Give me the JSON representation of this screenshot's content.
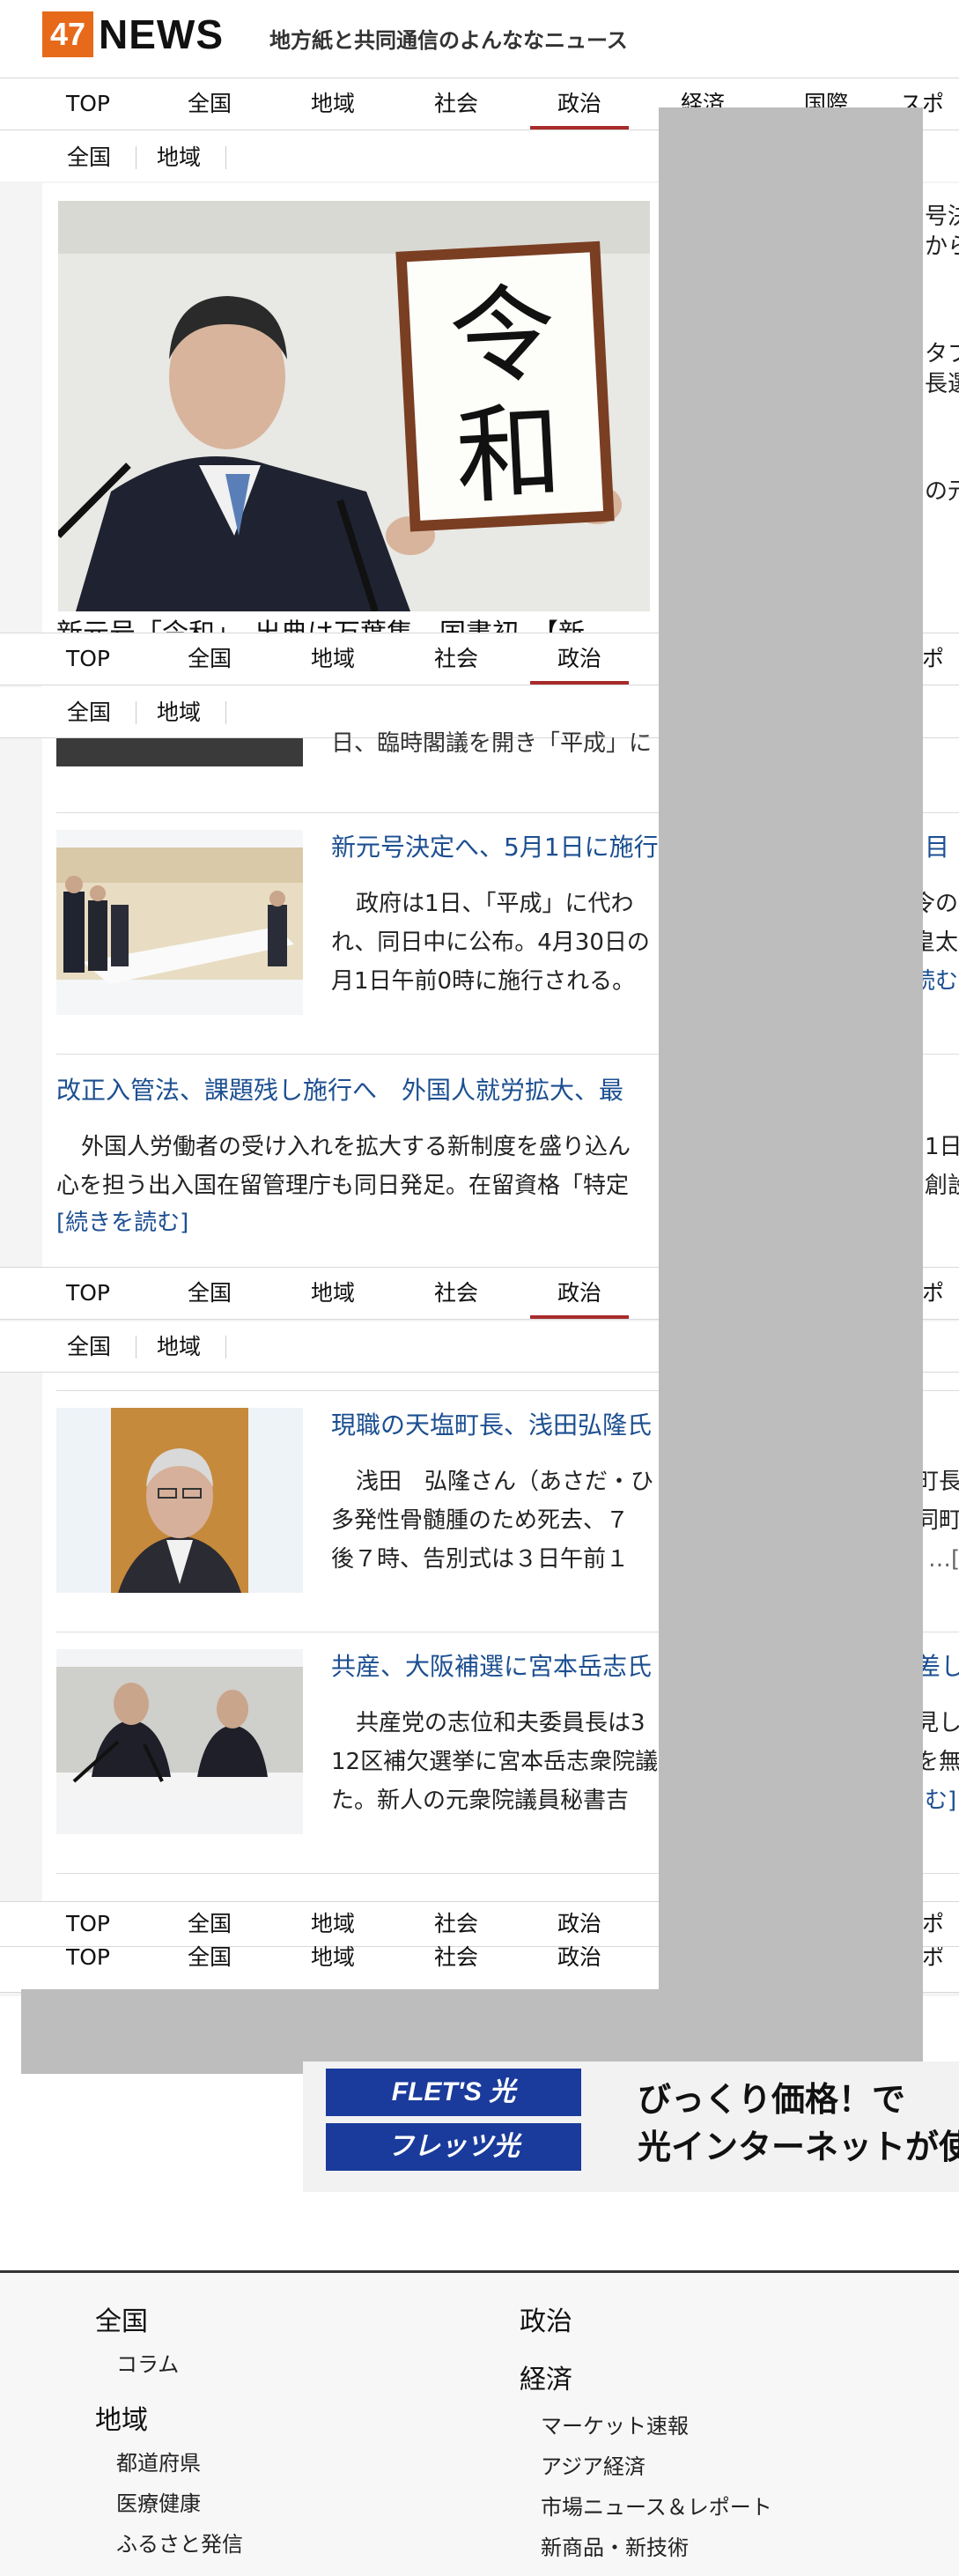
{
  "header": {
    "logo_number": "47",
    "logo_word": "NEWS",
    "tagline": "地方紙と共同通信のよんななニュース"
  },
  "nav": {
    "items": [
      "TOP",
      "全国",
      "地域",
      "社会",
      "政治",
      "経済",
      "国際",
      "スポ"
    ],
    "active": "政治",
    "sub": [
      "全国",
      "地域"
    ]
  },
  "hero": {
    "caption": "新元号「令和」　出典は万葉集、国書初　【新",
    "board_text": [
      "令",
      "和"
    ]
  },
  "articles": [
    {
      "headline": "新元号決定へ、5月1日に施行",
      "body": [
        "政府は1日、「平成」に代わ",
        "れ、同日中に公布。4月30日の",
        "月1日午前0時に施行される。"
      ],
      "readmore": "読む]"
    },
    {
      "headline": "改正入管法、課題残し施行へ　外国人就労拡大、最",
      "body": [
        "外国人労働者の受け入れを拡大する新制度を盛り込ん",
        "心を担う出入国在留管理庁も同日発足。在留資格「特定"
      ],
      "readmore": "[続きを読む]"
    },
    {
      "headline": "現職の天塩町長、浅田弘隆氏",
      "body": [
        "浅田　弘隆さん（あさだ・ひ",
        "多発性骨髄腫のため死去、７",
        "後７時、告別式は３日午前１"
      ]
    },
    {
      "headline": "共産、大阪補選に宮本岳志氏",
      "body": [
        "共産党の志位和夫委員長は3",
        "12区補欠選挙に宮本岳志衆院議",
        "た。新人の元衆院議員秘書吉"
      ],
      "readmore": "む]"
    }
  ],
  "fragments": {
    "right_edge": [
      "号決",
      "から",
      "タブ",
      "長選",
      "の元"
    ],
    "partial_previous_line": "日、臨時閣議を開き「平成」に",
    "right_col_1": [
      "目",
      "令の",
      "皇太",
      "読む]"
    ],
    "right_col_2": [
      "1日",
      "創設"
    ],
    "right_col_3": [
      "町長",
      "同町",
      "…["
    ],
    "right_col_4": [
      "差し",
      "見し",
      "を無"
    ]
  },
  "ad": {
    "badge_top": "FLET'S 光",
    "badge_bottom": "フレッツ光",
    "line1": "びっくり価格！で",
    "line2": "光インターネットが使"
  },
  "footer": {
    "col1": [
      {
        "title": "全国",
        "items": [
          "コラム"
        ]
      },
      {
        "title": "地域",
        "items": [
          "都道府県",
          "医療健康",
          "ふるさと発信"
        ]
      }
    ],
    "col2": [
      {
        "title": "政治",
        "items": []
      },
      {
        "title": "経済",
        "items": [
          "マーケット速報",
          "アジア経済",
          "市場ニュース＆レポート",
          "新商品・新技術"
        ]
      }
    ]
  },
  "colors": {
    "accent_red": "#a82b2b",
    "link_blue": "#1c4f91",
    "logo_orange": "#e66a1a",
    "overlay_gray": "#bdbdbd",
    "flets_blue": "#1a3b9c"
  }
}
